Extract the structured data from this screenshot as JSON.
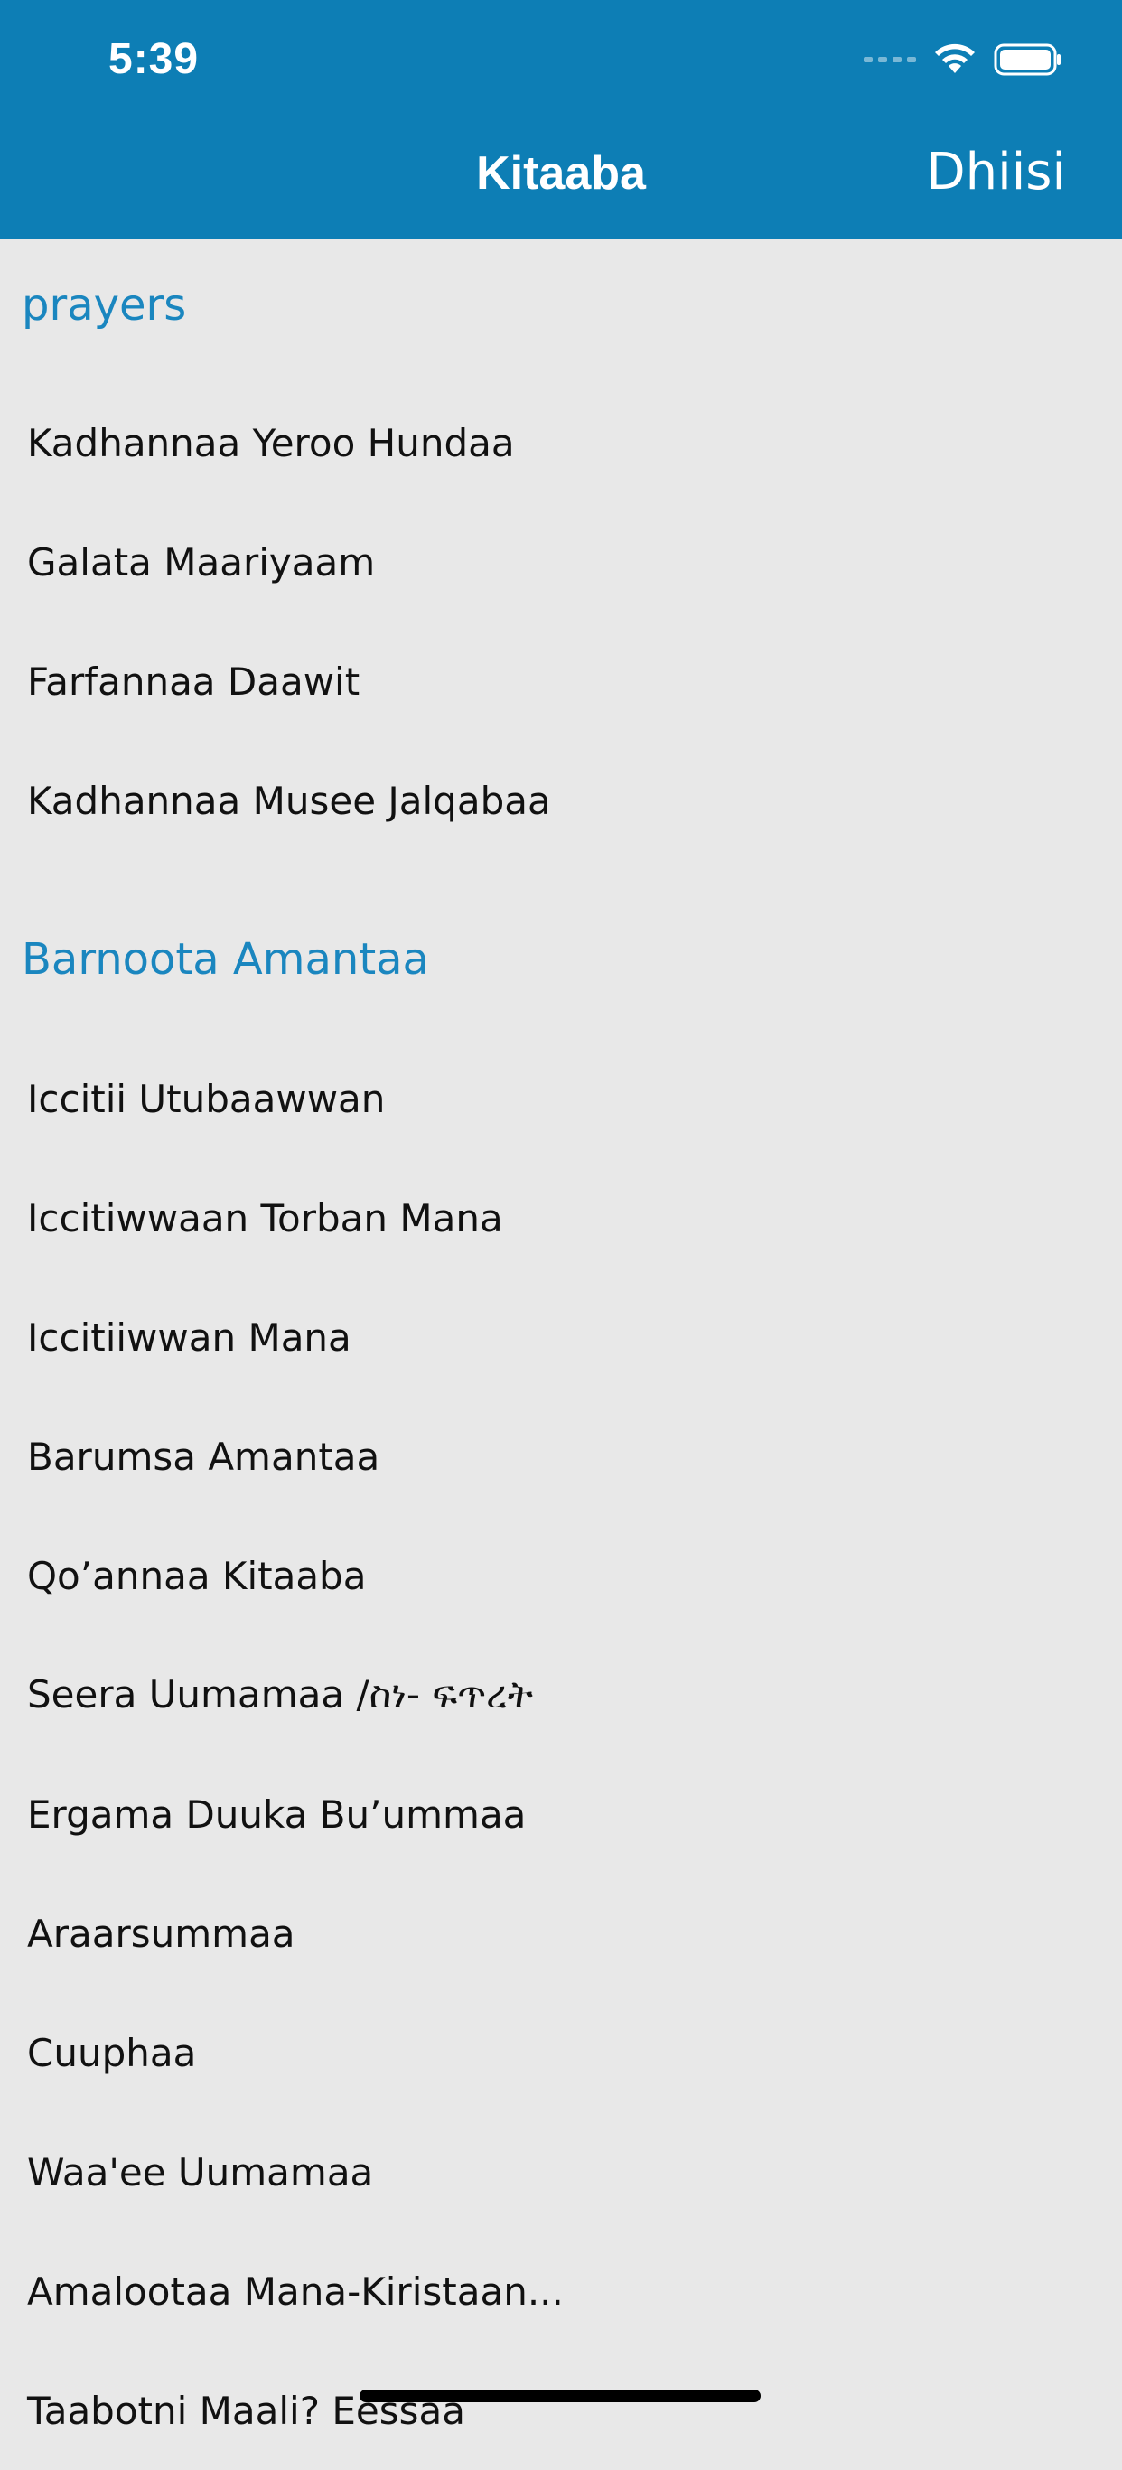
{
  "status_bar": {
    "time": "5:39"
  },
  "nav": {
    "title": "Kitaaba",
    "action": "Dhiisi"
  },
  "sections": [
    {
      "title": "prayers",
      "items": [
        "Kadhannaa Yeroo Hundaa",
        "Galata Maariyaam",
        "Farfannaa Daawit",
        "Kadhannaa Musee Jalqabaa"
      ]
    },
    {
      "title": "Barnoota Amantaa",
      "items": [
        "Iccitii Utubaawwan",
        "Iccitiwwaan Torban Mana",
        "Iccitiiwwan Mana",
        "Barumsa Amantaa",
        "Qo’annaa Kitaaba",
        "Seera Uumamaa /ስነ- ፍጥረት",
        "Ergama Duuka Bu’ummaa",
        "Araarsummaa",
        "Cuuphaa",
        "Waa'ee Uumamaa",
        "Amalootaa Mana-Kiristaan...",
        "Taabotni Maali? Eessaa"
      ]
    }
  ],
  "colors": {
    "header_bg": "#0d7eb5",
    "section_title": "#1a86bf",
    "background": "#e8e8e8"
  }
}
